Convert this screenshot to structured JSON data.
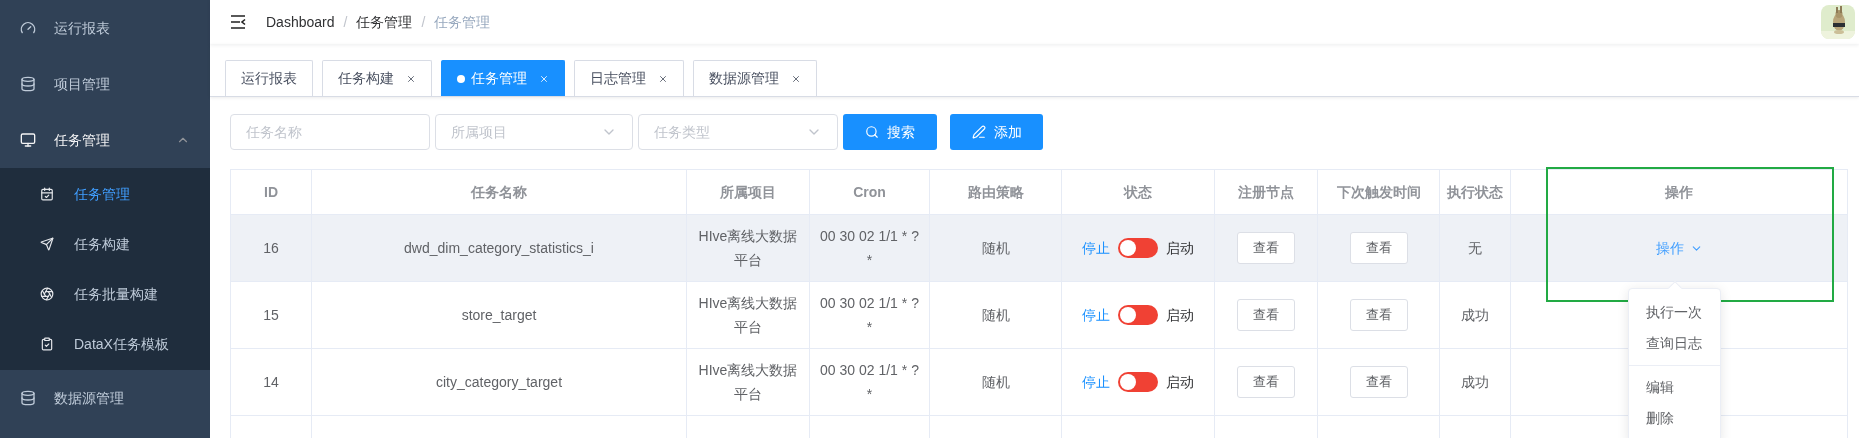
{
  "sidebar": {
    "items": [
      {
        "label": "运行报表",
        "selected": false
      },
      {
        "label": "项目管理",
        "selected": false
      },
      {
        "label": "任务管理",
        "selected": false,
        "expanded": true,
        "children": [
          {
            "label": "任务管理",
            "selected": true
          },
          {
            "label": "任务构建",
            "selected": false
          },
          {
            "label": "任务批量构建",
            "selected": false
          },
          {
            "label": "DataX任务模板",
            "selected": false
          }
        ]
      },
      {
        "label": "数据源管理",
        "selected": false
      }
    ]
  },
  "breadcrumb": [
    {
      "label": "Dashboard"
    },
    {
      "separator": "/",
      "label": "任务管理"
    },
    {
      "separator": "/",
      "label": "任务管理"
    }
  ],
  "tabs": [
    {
      "label": "运行报表",
      "selected": false,
      "closable": false
    },
    {
      "label": "任务构建",
      "selected": false,
      "closable": true
    },
    {
      "label": "任务管理",
      "selected": true,
      "closable": true
    },
    {
      "label": "日志管理",
      "selected": false,
      "closable": true
    },
    {
      "label": "数据源管理",
      "selected": false,
      "closable": true
    }
  ],
  "filters": {
    "name_field": {
      "placeholder": "任务名称"
    },
    "project_select": {
      "placeholder": "所属项目"
    },
    "type_select": {
      "placeholder": "任务类型"
    },
    "search_button": "搜索",
    "add_button": "添加"
  },
  "table": {
    "columns": [
      "ID",
      "任务名称",
      "所属项目",
      "Cron",
      "路由策略",
      "状态",
      "注册节点",
      "下次触发时间",
      "执行状态",
      "操作"
    ],
    "rows": [
      {
        "id": "16",
        "name": "dwd_dim_category_statistics_i",
        "project": "HIve离线大数据平台",
        "cron": "00 30 02 1/1 * ? *",
        "route": "随机",
        "stop_label": "停止",
        "on": false,
        "start_label": "启动",
        "node_button": "查看",
        "next_button": "查看",
        "exec_status": "无",
        "action": "操作",
        "hovered": true
      },
      {
        "id": "15",
        "name": "store_target",
        "project": "HIve离线大数据平台",
        "cron": "00 30 02 1/1 * ? *",
        "route": "随机",
        "stop_label": "停止",
        "on": false,
        "start_label": "启动",
        "node_button": "查看",
        "next_button": "查看",
        "exec_status": "成功",
        "hovered": false
      },
      {
        "id": "14",
        "name": "city_category_target",
        "project": "HIve离线大数据平台",
        "cron": "00 30 02 1/1 * ? *",
        "route": "随机",
        "stop_label": "停止",
        "on": false,
        "start_label": "启动",
        "node_button": "查看",
        "next_button": "查看",
        "exec_status": "成功",
        "hovered": false
      }
    ]
  },
  "action_menu": {
    "items": [
      {
        "label": "执行一次",
        "divided": false
      },
      {
        "label": "查询日志",
        "divided": false
      },
      {
        "label": "编辑",
        "divided": true
      },
      {
        "label": "删除",
        "divided": false
      }
    ]
  }
}
